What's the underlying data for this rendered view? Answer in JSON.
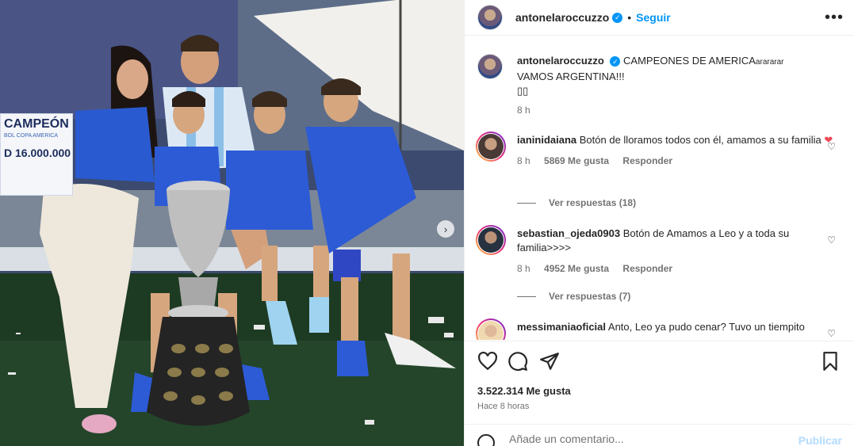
{
  "post": {
    "author": "antonelaroccuzzo",
    "follow_label": "Seguir",
    "dot": "•",
    "more": "•••",
    "verified_mark": "✓"
  },
  "photo": {
    "banner_title": "CAMPEÓN",
    "banner_sub": "BOL COPA AMERICA",
    "banner_amount": "D 16.000.000",
    "next_arrow": "›"
  },
  "caption": {
    "author": "antonelaroccuzzo",
    "text_line1": "CAMPEONES DE AMERICA",
    "text_suffix": "arararar",
    "text_line2": "VAMOS ARGENTINA!!!",
    "emoji_line": "▯▯",
    "time": "8 h"
  },
  "comments": [
    {
      "user": "ianinidaiana",
      "text": "Botón de lloramos todos con él, amamos a su familia",
      "emoji": "❤",
      "time": "8 h",
      "likes": "5869 Me gusta",
      "reply": "Responder",
      "replies_label": "Ver respuestas (18)"
    },
    {
      "user": "sebastian_ojeda0903",
      "text": "Botón de Amamos a Leo y a toda su familia>>>>",
      "time": "8 h",
      "likes": "4952 Me gusta",
      "reply": "Responder",
      "replies_label": "Ver respuestas (7)"
    },
    {
      "user": "messimaniaoficial",
      "text": "Anto, Leo ya pudo cenar? Tuvo un tiempito"
    }
  ],
  "actions": {
    "likes_count": "3.522.314 Me gusta",
    "time_ago": "Hace 8 horas"
  },
  "add_comment": {
    "placeholder": "Añade un comentario...",
    "post_label": "Publicar"
  },
  "icons": {
    "like": "heart-icon",
    "comment": "comment-icon",
    "share": "share-icon",
    "save": "bookmark-icon",
    "emoji": "emoji-icon",
    "more": "more-options-icon"
  },
  "colors": {
    "accent": "#0095f6",
    "like_red": "#ed4956",
    "muted": "#737373"
  }
}
